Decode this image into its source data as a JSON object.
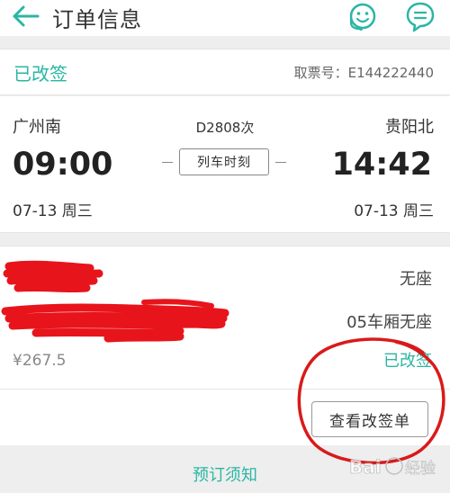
{
  "header": {
    "title": "订单信息"
  },
  "status": {
    "label": "已改签",
    "ticket_number": "取票号：E144222440"
  },
  "trip": {
    "from_station": "广州南",
    "to_station": "贵阳北",
    "train_number": "D2808次",
    "departure_time": "09:00",
    "arrival_time": "14:42",
    "departure_date": "07-13 周三",
    "arrival_date": "07-13 周三",
    "timetable_label": "列车时刻"
  },
  "passenger": {
    "seat_type": "无座",
    "seat_detail": "05车厢无座",
    "price": "¥267.5",
    "change_status": "已改签",
    "view_change_label": "查看改签单"
  },
  "footer": {
    "booking_notice": "预订须知"
  },
  "watermark": {
    "text": "Bai 经验"
  },
  "colors": {
    "accent": "#2bb6a3",
    "redaction": "#e8141b",
    "annotation": "#d91a1a"
  },
  "icons": [
    "back-arrow-icon",
    "customer-service-icon",
    "chat-bubble-icon"
  ]
}
